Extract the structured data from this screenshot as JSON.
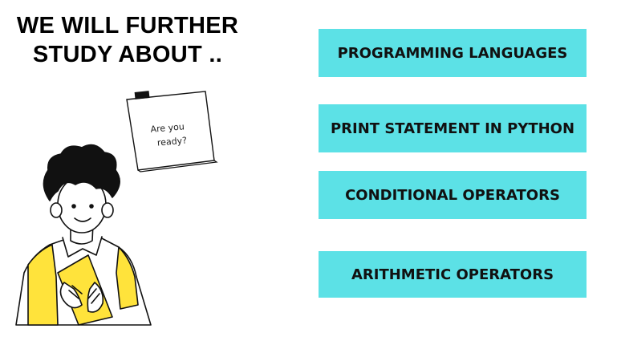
{
  "slide": {
    "title_line1": "WE WILL FURTHER",
    "title_line2": "STUDY ABOUT ..",
    "note_line1": "Are you",
    "note_line2": "ready?",
    "topics": [
      {
        "label": "PROGRAMMING LANGUAGES"
      },
      {
        "label": "PRINT STATEMENT IN PYTHON"
      },
      {
        "label": "CONDITIONAL OPERATORS"
      },
      {
        "label": "ARITHMETIC OPERATORS"
      }
    ]
  },
  "colors": {
    "topic_background": "#5ce1e6",
    "shirt_yellow": "#ffe33b"
  }
}
